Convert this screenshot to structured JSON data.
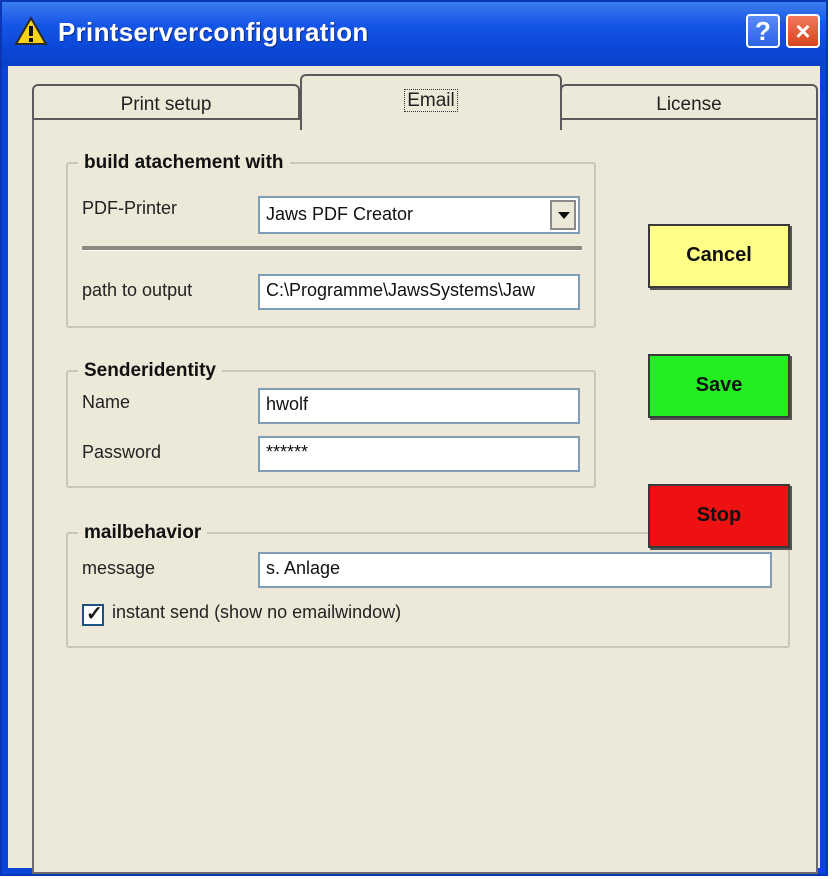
{
  "window": {
    "title": "Printserverconfiguration",
    "help_label": "?",
    "close_label": "×"
  },
  "tabs": [
    {
      "label": "Print setup",
      "selected": false
    },
    {
      "label": "Email",
      "selected": true
    },
    {
      "label": "License",
      "selected": false
    }
  ],
  "attachment": {
    "legend": "build atachement with",
    "printer_label": "PDF-Printer",
    "printer_value": "Jaws PDF Creator",
    "path_label": "path to output",
    "path_value": "C:\\Programme\\JawsSystems\\Jaw"
  },
  "sender": {
    "legend": "Senderidentity",
    "name_label": "Name",
    "name_value": "hwolf",
    "password_label": "Password",
    "password_value": "******"
  },
  "mail": {
    "legend": "mailbehavior",
    "message_label": "message",
    "message_value": "s. Anlage",
    "instant_send_label": "instant send (show no emailwindow)",
    "instant_send_checked": true
  },
  "buttons": {
    "cancel": "Cancel",
    "save": "Save",
    "stop": "Stop"
  },
  "colors": {
    "titlebar": "#0a48d8",
    "cancel": "#ffff88",
    "save": "#22ee22",
    "stop": "#ee1111",
    "panel": "#ece9d8"
  },
  "icons": {
    "title": "warning-icon",
    "dropdown": "chevron-down-icon",
    "check": "check-icon"
  }
}
